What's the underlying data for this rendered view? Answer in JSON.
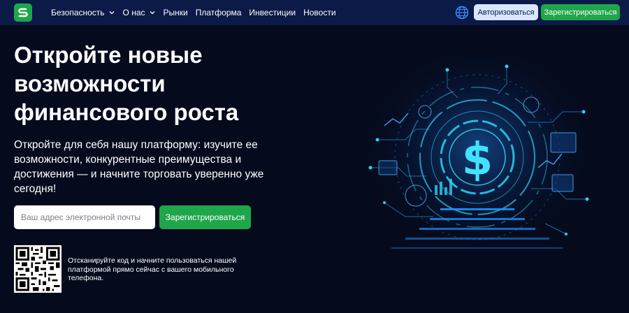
{
  "nav": {
    "logo_icon": "s-logo-icon",
    "items": [
      {
        "label": "Безопасность",
        "has_dropdown": true
      },
      {
        "label": "О нас",
        "has_dropdown": true
      },
      {
        "label": "Рынки",
        "has_dropdown": false
      },
      {
        "label": "Платформа",
        "has_dropdown": false
      },
      {
        "label": "Инвестиции",
        "has_dropdown": false
      },
      {
        "label": "Новости",
        "has_dropdown": false
      }
    ],
    "language_icon": "globe-icon",
    "login_label": "Авторизоваться",
    "register_label": "Зарегистрироваться"
  },
  "hero": {
    "title": "Откройте новые возможности финансового роста",
    "subtitle": "Откройте для себя нашу платформу: изучите ее возможности, конкурентные преимущества и достижения — и начните торговать уверенно уже сегодня!",
    "email_placeholder": "Ваш адрес электронной почты",
    "email_value": "",
    "register_label": "Зарегистрироваться",
    "qr_text": "Отсканируйте код и начните пользоваться нашей платформой прямо сейчас с вашего мобильного телефона.",
    "art_icon": "dollar-hologram-icon"
  },
  "colors": {
    "background": "#050b1d",
    "navbar": "#0b1a47",
    "accent_green": "#1fa64a",
    "login_button": "#d8e6ff",
    "hologram_cyan": "#29d3f5"
  }
}
